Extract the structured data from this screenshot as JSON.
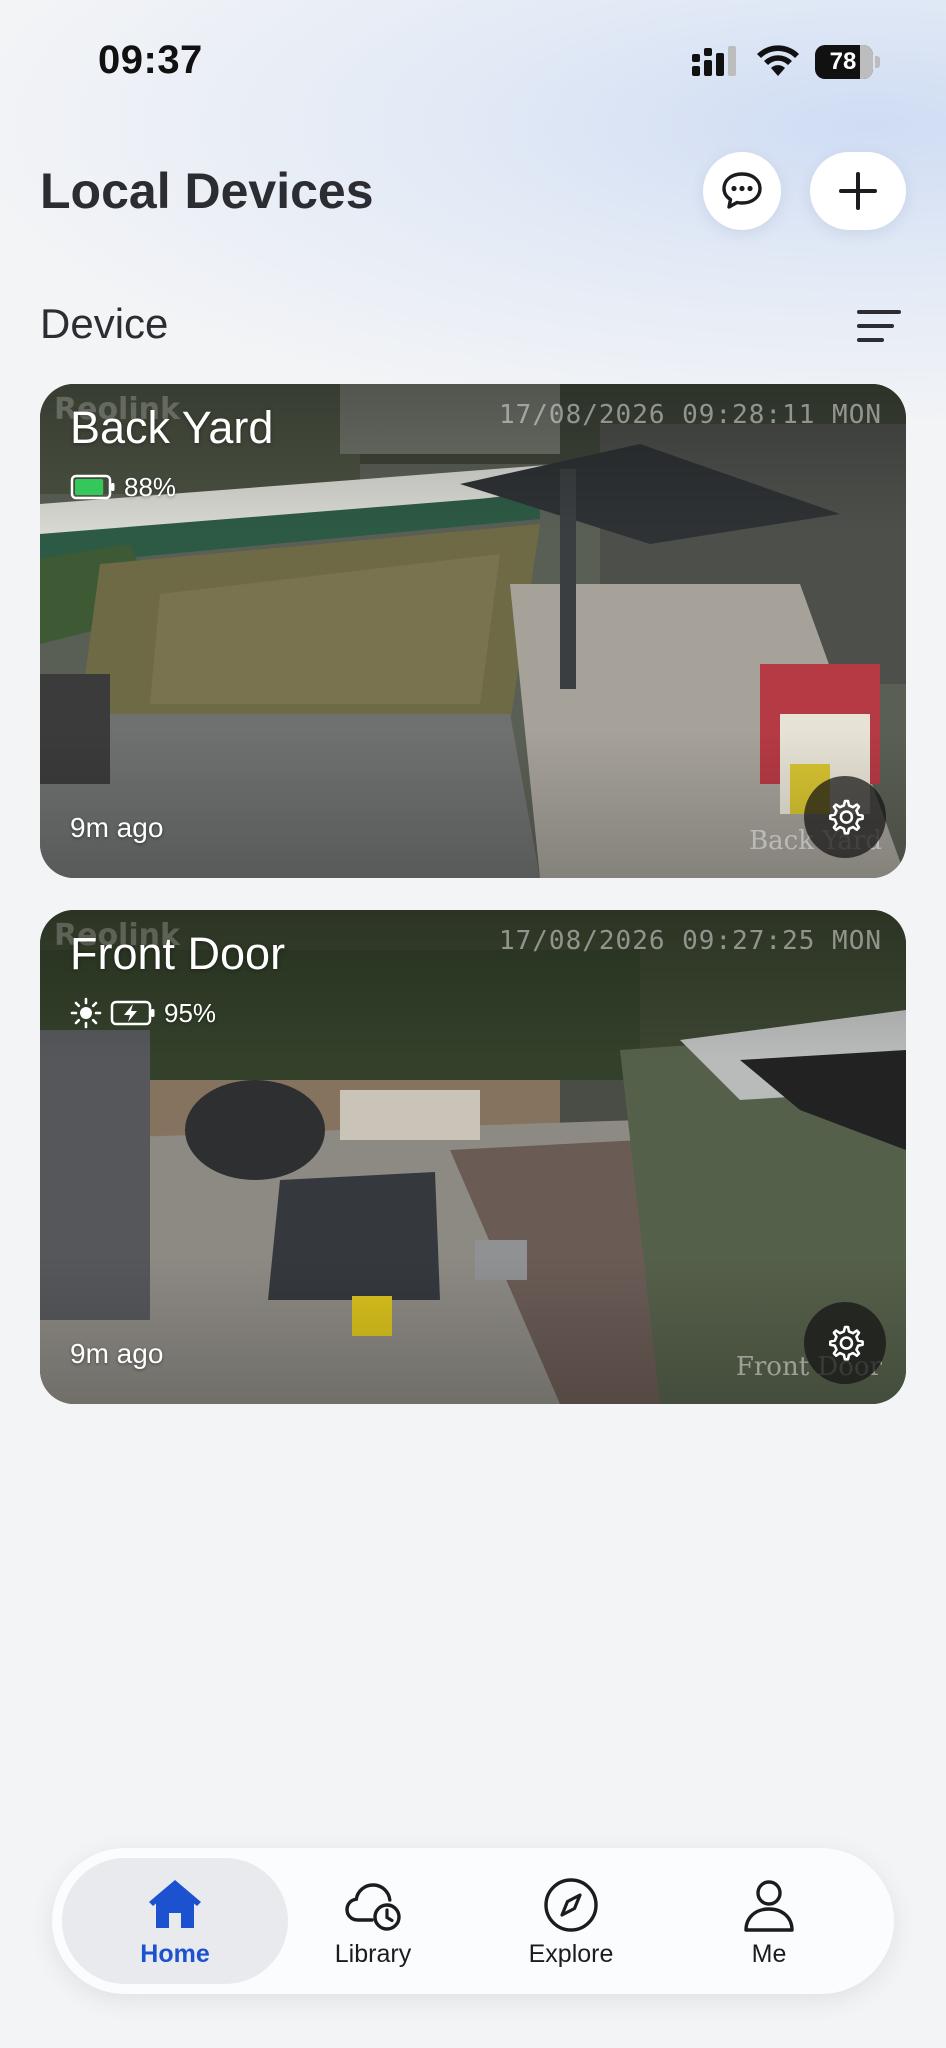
{
  "status_bar": {
    "time": "09:37",
    "battery_level": "78",
    "battery_fraction": 0.78
  },
  "header": {
    "title": "Local Devices",
    "chat_icon": "chat-bubble-icon",
    "add_icon": "plus-icon"
  },
  "section": {
    "title": "Device",
    "sort_icon": "sort-lines-icon"
  },
  "devices": [
    {
      "name": "Back Yard",
      "battery": "88%",
      "battery_fraction": 0.88,
      "solar": false,
      "charging": false,
      "last_seen": "9m ago",
      "overlay_timestamp": "17/08/2026 09:28:11 MON",
      "overlay_name": "Back Yard",
      "overlay_brand": "Reolink"
    },
    {
      "name": "Front Door",
      "battery": "95%",
      "battery_fraction": 0.95,
      "solar": true,
      "charging": true,
      "last_seen": "9m ago",
      "overlay_timestamp": "17/08/2026 09:27:25 MON",
      "overlay_name": "Front Door",
      "overlay_brand": "Reolink"
    }
  ],
  "tabs": [
    {
      "label": "Home",
      "icon": "home-icon",
      "active": true
    },
    {
      "label": "Library",
      "icon": "cloud-clock-icon",
      "active": false
    },
    {
      "label": "Explore",
      "icon": "compass-icon",
      "active": false
    },
    {
      "label": "Me",
      "icon": "person-icon",
      "active": false
    }
  ],
  "colors": {
    "accent": "#1c52d0",
    "battery_green": "#34c759",
    "background": "#f3f4f6"
  }
}
